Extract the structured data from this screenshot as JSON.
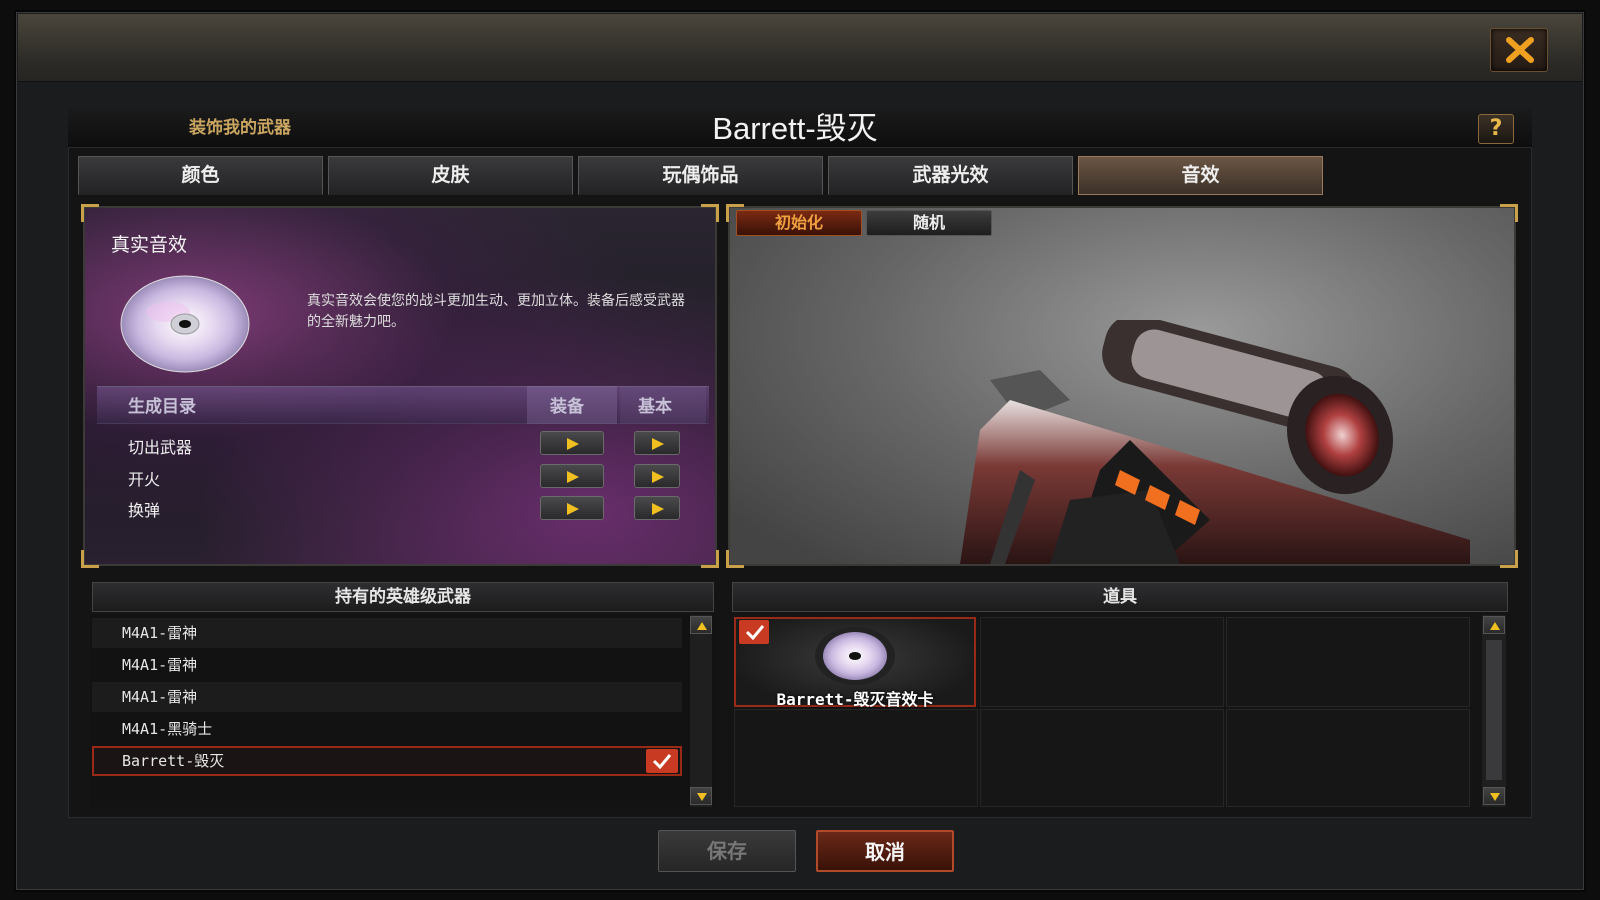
{
  "dialog": {
    "subtitle": "装饰我的武器",
    "weapon_title": "Barrett-毁灭",
    "help_label": "?"
  },
  "tabs": [
    {
      "label": "颜色",
      "active": false
    },
    {
      "label": "皮肤",
      "active": false
    },
    {
      "label": "玩偶饰品",
      "active": false
    },
    {
      "label": "武器光效",
      "active": false
    },
    {
      "label": "音效",
      "active": true
    }
  ],
  "sound_panel": {
    "title": "真实音效",
    "description": "真实音效会使您的战斗更加生动、更加立体。装备后感受武器的全新魅力吧。",
    "list_header": "生成目录",
    "col_equip": "装备",
    "col_basic": "基本",
    "rows": [
      {
        "label": "切出武器"
      },
      {
        "label": "开火"
      },
      {
        "label": "换弹"
      }
    ]
  },
  "preview": {
    "reset_label": "初始化",
    "random_label": "随机"
  },
  "hero_weapons": {
    "header": "持有的英雄级武器",
    "items": [
      {
        "label": "M4A1-雷神",
        "selected": false
      },
      {
        "label": "M4A1-雷神",
        "selected": false
      },
      {
        "label": "M4A1-雷神",
        "selected": false
      },
      {
        "label": "M4A1-黑骑士",
        "selected": false
      },
      {
        "label": "Barrett-毁灭",
        "selected": true
      }
    ]
  },
  "items_panel": {
    "header": "道具",
    "items": [
      {
        "label": "Barrett-毁灭音效卡",
        "checked": true,
        "icon": "sound-disc-icon"
      }
    ]
  },
  "footer": {
    "save_label": "保存",
    "cancel_label": "取消"
  },
  "colors": {
    "accent_orange": "#c8a14a",
    "selection_red": "#c83a22",
    "close_x": "#f0a020"
  }
}
